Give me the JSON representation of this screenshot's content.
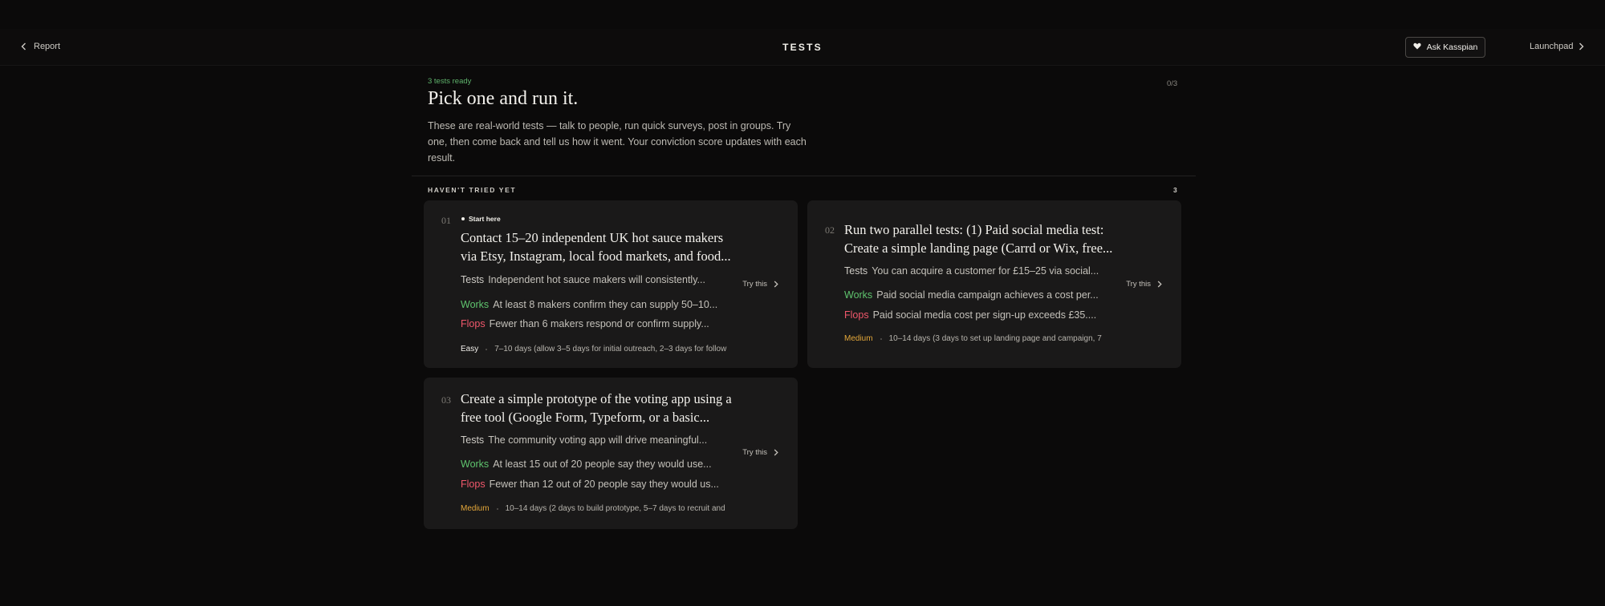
{
  "header": {
    "back_label": "Report",
    "title": "TESTS",
    "ask_label": "Ask Kasspian",
    "launchpad_label": "Launchpad"
  },
  "intro": {
    "status": "3 tests ready",
    "progress": "0/3",
    "headline": "Pick one and run it.",
    "description": "These are real-world tests — talk to people, run quick surveys, post in groups. Try one, then come back and tell us how it went. Your conviction score updates with each result."
  },
  "section": {
    "label": "HAVEN'T TRIED YET",
    "count": "3"
  },
  "labels": {
    "tests": "Tests",
    "works": "Works",
    "flops": "Flops",
    "try": "Try this"
  },
  "colors": {
    "works": "#5fc46e",
    "flops": "#f0576b",
    "medium": "#e5a83a",
    "ready": "#5fb36c"
  },
  "cards": [
    {
      "number": "01",
      "badge": "Start here",
      "title": "Contact 15–20 independent UK hot sauce makers via Etsy, Instagram, local food markets, and food...",
      "tests": "Independent hot sauce makers will consistently...",
      "works": "At least 8 makers confirm they can supply 50–10...",
      "flops": "Fewer than 6 makers respond or confirm supply...",
      "difficulty": "Easy",
      "duration": "7–10 days (allow 3–5 days for initial outreach, 2–3 days for follow"
    },
    {
      "number": "02",
      "badge": "",
      "title": "Run two parallel tests: (1) Paid social media test: Create a simple landing page (Carrd or Wix, free...",
      "tests": "You can acquire a customer for £15–25 via social...",
      "works": "Paid social media campaign achieves a cost per...",
      "flops": "Paid social media cost per sign-up exceeds £35....",
      "difficulty": "Medium",
      "duration": "10–14 days (3 days to set up landing page and campaign, 7"
    },
    {
      "number": "03",
      "badge": "",
      "title": "Create a simple prototype of the voting app using a free tool (Google Form, Typeform, or a basic...",
      "tests": "The community voting app will drive meaningful...",
      "works": "At least 15 out of 20 people say they would use...",
      "flops": "Fewer than 12 out of 20 people say they would us...",
      "difficulty": "Medium",
      "duration": "10–14 days (2 days to build prototype, 5–7 days to recruit and"
    }
  ]
}
